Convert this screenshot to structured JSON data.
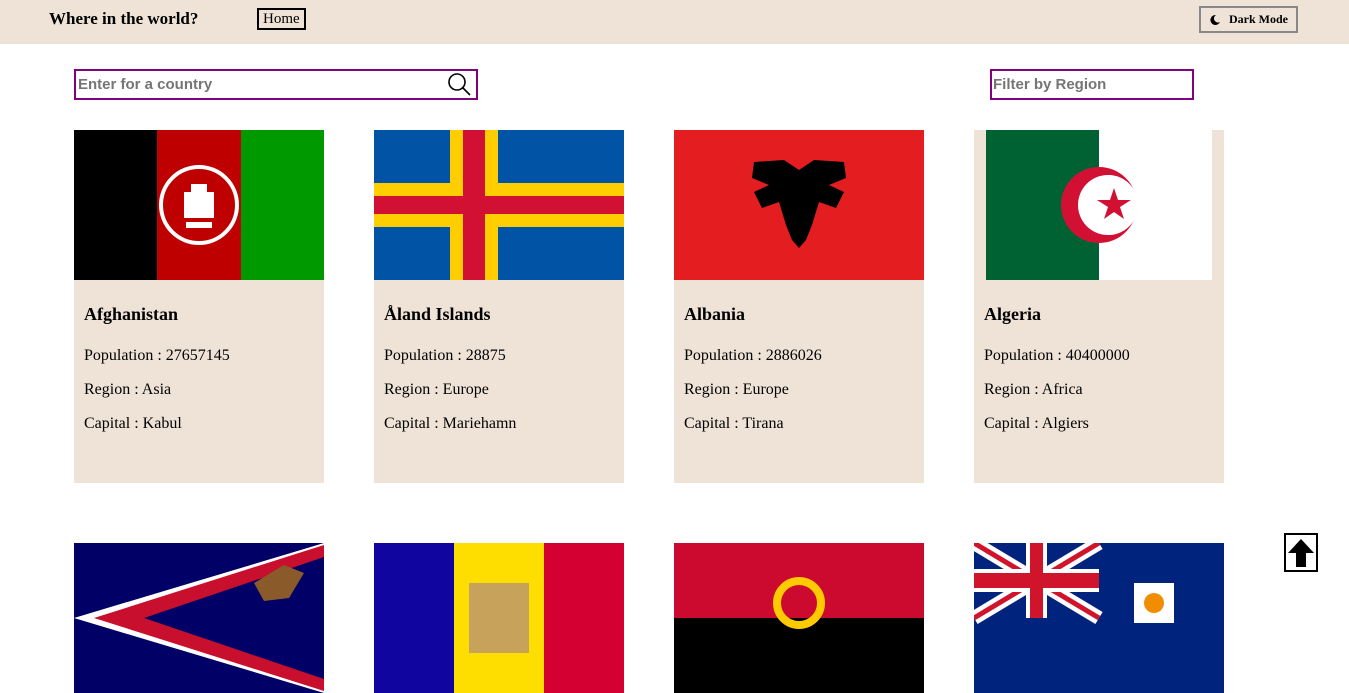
{
  "header": {
    "title": "Where in the world?",
    "home_label": "Home",
    "dark_mode_label": "Dark Mode",
    "dark_mode_icon": "moon-icon"
  },
  "search": {
    "placeholder": "Enter for a country",
    "value": "",
    "icon": "search-icon"
  },
  "filter": {
    "placeholder": "Filter by Region"
  },
  "labels": {
    "population": "Population : ",
    "region": "Region : ",
    "capital": "Capital : "
  },
  "countries": [
    {
      "name": "Afghanistan",
      "population": "27657145",
      "region": "Asia",
      "capital": "Kabul"
    },
    {
      "name": "Åland Islands",
      "population": "28875",
      "region": "Europe",
      "capital": "Mariehamn"
    },
    {
      "name": "Albania",
      "population": "2886026",
      "region": "Europe",
      "capital": "Tirana"
    },
    {
      "name": "Algeria",
      "population": "40400000",
      "region": "Africa",
      "capital": "Algiers"
    }
  ],
  "colors": {
    "header_bg": "#eee3d6",
    "card_bg": "#eee3d6",
    "input_border": "#800080"
  },
  "scroll_top_icon": "arrow-up-icon"
}
